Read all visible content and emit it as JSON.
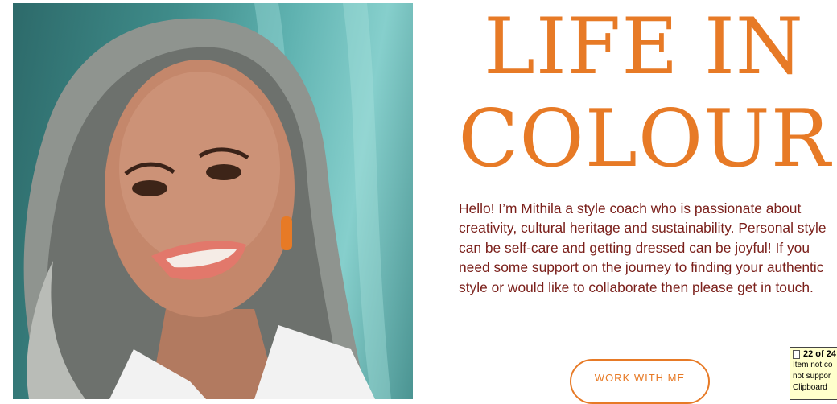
{
  "hero": {
    "title_line1": "LIFE IN",
    "title_line2": "COLOUR",
    "bio": "Hello!  I’m Mithila a style coach who is passionate about creativity, cultural heritage and sustainability. Personal style can be self-care and getting dressed can be joyful! If you need some support on the journey to finding your authentic style or would like to collaborate then please get in touch.",
    "cta_label": "WORK WITH ME"
  },
  "clipboard_tooltip": {
    "count": "22 of 24",
    "line1": "Item not co",
    "line2": "not suppor",
    "line3": "Clipboard"
  },
  "colors": {
    "accent": "#e77a26",
    "text": "#7a1f1a"
  }
}
